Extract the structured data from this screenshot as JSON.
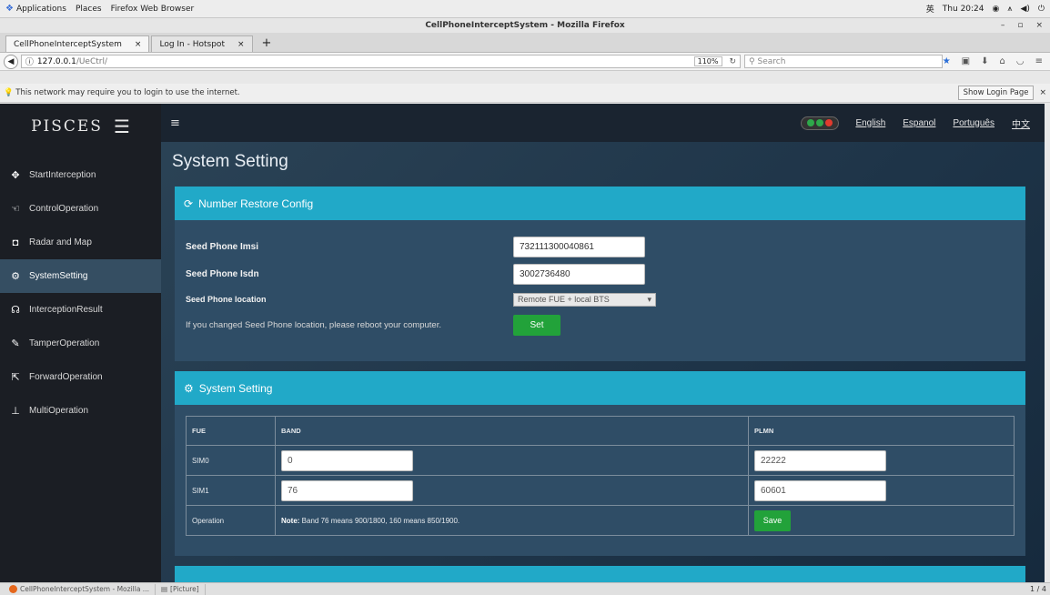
{
  "gnome": {
    "menu": [
      "Applications",
      "Places",
      "Firefox Web Browser"
    ],
    "input_method": "英",
    "clock": "Thu 20:24"
  },
  "window": {
    "title": "CellPhoneInterceptSystem - Mozilla Firefox"
  },
  "tabs": [
    {
      "label": "CellPhoneInterceptSystem"
    },
    {
      "label": "Log In - Hotspot"
    }
  ],
  "urlbar": {
    "host": "127.0.0.1",
    "path": "/UeCtrl/",
    "zoom": "110%",
    "search_placeholder": "Search"
  },
  "notice": {
    "text": "This network may require you to login to use the internet.",
    "button": "Show Login Page"
  },
  "app": {
    "brand": "PISCES",
    "nav": [
      {
        "label": "StartInterception",
        "icon": "crosshair-icon"
      },
      {
        "label": "ControlOperation",
        "icon": "hand-icon"
      },
      {
        "label": "Radar and Map",
        "icon": "camera-icon"
      },
      {
        "label": "SystemSetting",
        "icon": "gears-icon"
      },
      {
        "label": "InterceptionResult",
        "icon": "headphones-icon"
      },
      {
        "label": "TamperOperation",
        "icon": "edit-icon"
      },
      {
        "label": "ForwardOperation",
        "icon": "share-icon"
      },
      {
        "label": "MultiOperation",
        "icon": "sitemap-icon"
      }
    ],
    "languages": [
      "English",
      "Espanol",
      "Português",
      "中文"
    ],
    "signal_colors": [
      "#2ea84a",
      "#2ea84a",
      "#e23b2e"
    ],
    "page_title": "System Setting",
    "restore_panel": {
      "title": "Number Restore Config",
      "imsi_label": "Seed Phone Imsi",
      "imsi_value": "732111300040861",
      "isdn_label": "Seed Phone Isdn",
      "isdn_value": "3002736480",
      "location_label": "Seed Phone location",
      "location_value": "Remote FUE + local BTS",
      "notice": "If you changed Seed Phone location, please reboot your computer.",
      "set_button": "Set"
    },
    "settings_panel": {
      "title": "System Setting",
      "headers": [
        "FUE",
        "BAND",
        "PLMN"
      ],
      "rows": [
        {
          "name": "SIM0",
          "band": "0",
          "plmn": "22222"
        },
        {
          "name": "SIM1",
          "band": "76",
          "plmn": "60601"
        }
      ],
      "operation_label": "Operation",
      "note_label": "Note:",
      "note_text": " Band 76 means 900/1800, 160 means 850/1900.",
      "save_button": "Save"
    }
  },
  "taskbar": {
    "items": [
      "CellPhoneInterceptSystem - Mozilla ...",
      "[Picture]"
    ],
    "pager": "1 / 4"
  }
}
